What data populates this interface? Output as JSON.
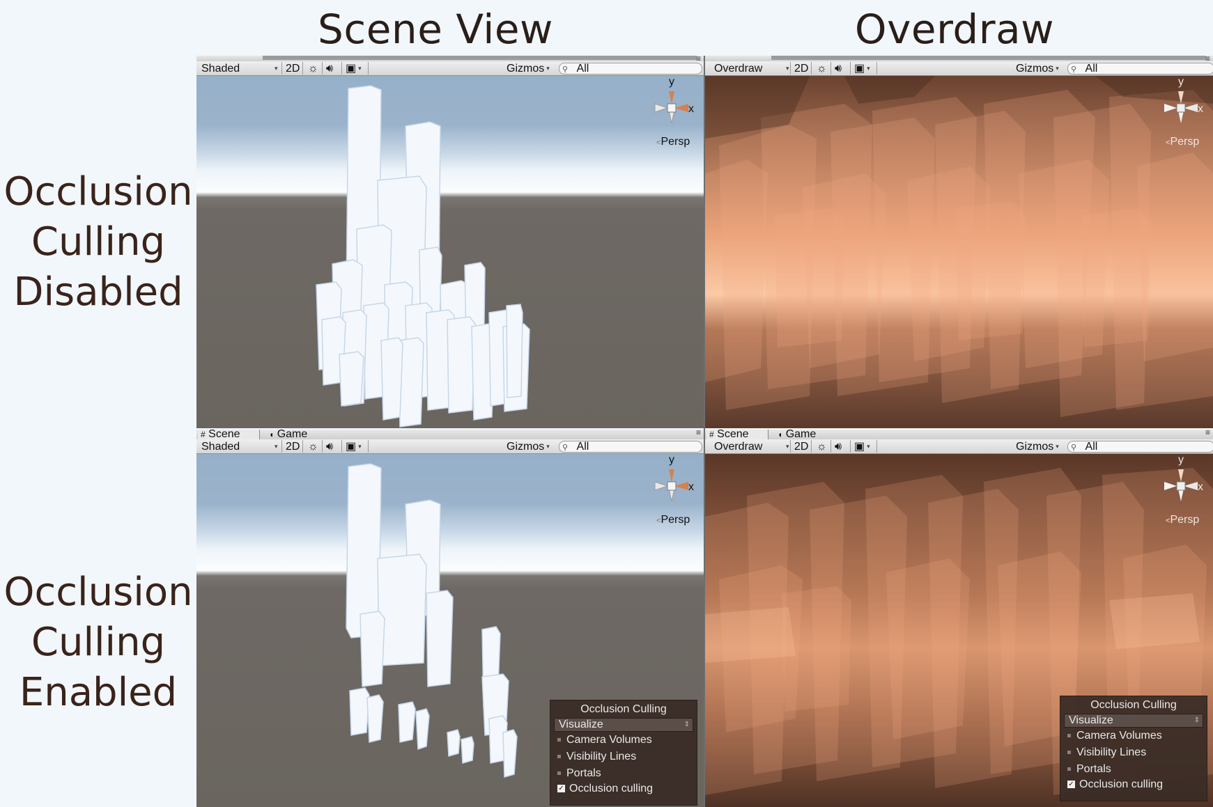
{
  "headings": {
    "scene_view": "Scene View",
    "overdraw": "Overdraw"
  },
  "row_labels": {
    "disabled": [
      "Occlusion",
      "Culling",
      "Disabled"
    ],
    "enabled": [
      "Occlusion",
      "Culling",
      "Enabled"
    ]
  },
  "tabs": {
    "scene": "Scene",
    "game": "Game",
    "menu_icon": "menu-icon"
  },
  "toolbar": {
    "mode_shaded": "Shaded",
    "mode_overdraw": "Overdraw",
    "btn_2d": "2D",
    "lighting_icon": "sun-icon",
    "audio_icon": "speaker-icon",
    "effects_icon": "image-icon",
    "gizmos": "Gizmos",
    "search_value": "All",
    "search_icon": "search-icon"
  },
  "gizmo": {
    "y_axis": "y",
    "x_axis": "x",
    "projection": "Persp"
  },
  "occlusion_panel": {
    "title": "Occlusion Culling",
    "dropdown_value": "Visualize",
    "items": [
      "Camera Volumes",
      "Visibility Lines",
      "Portals"
    ],
    "checkbox_label": "Occlusion culling",
    "checkbox_checked": true
  },
  "colors": {
    "page_bg": "#f1f7fa",
    "sky": "#9ab3cb",
    "ground": "#6a655f",
    "buildings": "#eef4fb",
    "overdraw_base": "#4d3225",
    "overdraw_hot": "#ffc9a0",
    "panel_bg": "#3a2c26"
  }
}
